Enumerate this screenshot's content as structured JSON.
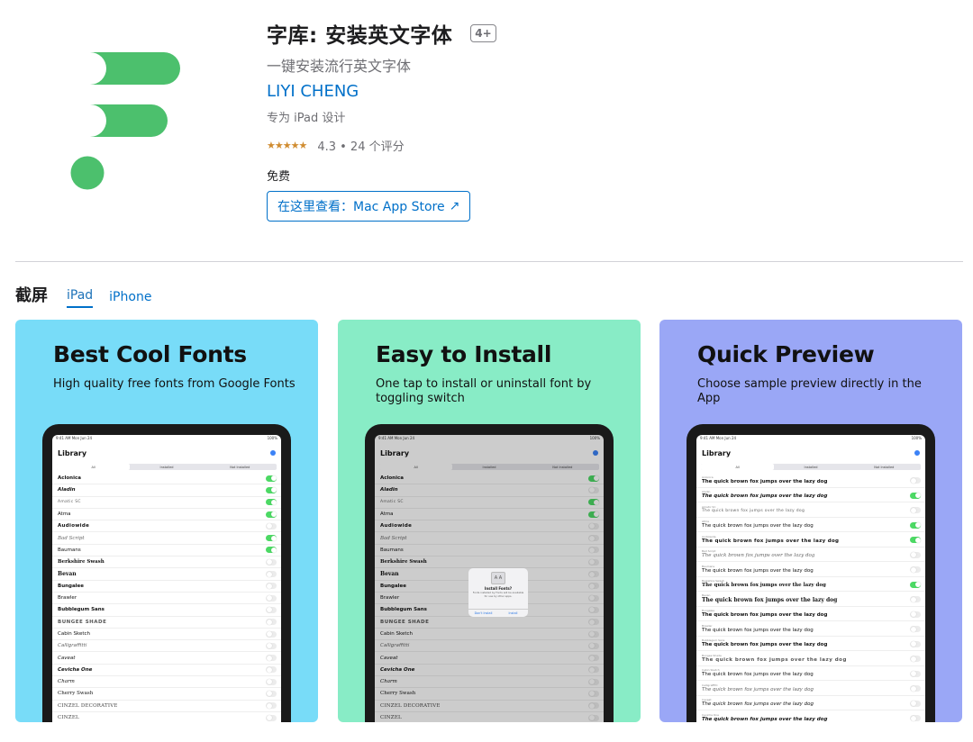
{
  "app": {
    "title": "字库: 安装英文字体",
    "age_rating": "4+",
    "subtitle": "一键安装流行英文字体",
    "developer": "LIYI CHENG",
    "designed_for": "专为 iPad 设计",
    "stars": "★★★★★",
    "rating_text": "4.3 • 24 个评分",
    "rating_value": 4.3,
    "price": "免费",
    "store_button": "在这里查看：Mac App Store",
    "store_arrow": "↗",
    "icon_color": "#4cc06d"
  },
  "screenshots": {
    "title": "截屏",
    "tabs": [
      "iPad",
      "iPhone"
    ],
    "active_tab": "iPad"
  },
  "mock": {
    "status_left": "9:41 AM   Mon Jun 24",
    "status_right": "100%",
    "library": "Library",
    "segments": [
      "All",
      "Installed",
      "Not Installed"
    ],
    "sample_text": "The quick brown fox jumps over the lazy dog",
    "dialog_icon": "A A",
    "dialog_title": "Install Fonts?",
    "dialog_body": "Fonts installed by Fonts will be available for use by other apps.",
    "dialog_left": "Don't Install",
    "dialog_right": "Install"
  },
  "cards": [
    {
      "title": "Best Cool Fonts",
      "subtitle": "High quality free fonts from Google Fonts",
      "bg": "#78dcf8",
      "fonts": [
        {
          "name": "Aclonica",
          "on": true
        },
        {
          "name": "Aladin",
          "on": true
        },
        {
          "name": "Amatic SC",
          "on": true
        },
        {
          "name": "Atma",
          "on": true
        },
        {
          "name": "Audiowide",
          "on": false
        },
        {
          "name": "Bad Script",
          "on": true
        },
        {
          "name": "Baumans",
          "on": true
        },
        {
          "name": "Berkshire Swash",
          "on": false
        },
        {
          "name": "Bevan",
          "on": false
        },
        {
          "name": "Bungalee",
          "on": false
        },
        {
          "name": "Brawler",
          "on": false
        },
        {
          "name": "Bubblegum Sans",
          "on": false
        },
        {
          "name": "BUNGEE SHADE",
          "on": false
        },
        {
          "name": "Cabin Sketch",
          "on": false
        },
        {
          "name": "Calligraffitti",
          "on": false
        },
        {
          "name": "Caveat",
          "on": false
        },
        {
          "name": "Cevicha One",
          "on": false
        },
        {
          "name": "Charm",
          "on": false
        },
        {
          "name": "Cherry Swash",
          "on": false
        },
        {
          "name": "CINZEL DECORATIVE",
          "on": false
        },
        {
          "name": "CINZEL",
          "on": false
        }
      ]
    },
    {
      "title": "Easy to Install",
      "subtitle": "One tap to install or uninstall font by toggling switch",
      "bg": "#88ecc6",
      "fonts": [
        {
          "name": "Aclonica",
          "on": true
        },
        {
          "name": "Aladin",
          "on": false
        },
        {
          "name": "Amatic SC",
          "on": true
        },
        {
          "name": "Atma",
          "on": true
        },
        {
          "name": "Audiowide",
          "on": false
        },
        {
          "name": "Bad Script",
          "on": false
        },
        {
          "name": "Baumans",
          "on": false
        },
        {
          "name": "Berkshire Swash",
          "on": false
        },
        {
          "name": "Bevan",
          "on": false
        },
        {
          "name": "Bungalee",
          "on": false
        },
        {
          "name": "Brawler",
          "on": false
        },
        {
          "name": "Bubblegum Sans",
          "on": false
        },
        {
          "name": "BUNGEE SHADE",
          "on": false
        },
        {
          "name": "Cabin Sketch",
          "on": false
        },
        {
          "name": "Calligraffitti",
          "on": false
        },
        {
          "name": "Caveat",
          "on": false
        },
        {
          "name": "Cevicha One",
          "on": false
        },
        {
          "name": "Charm",
          "on": false
        },
        {
          "name": "Cherry Swash",
          "on": false
        },
        {
          "name": "CINZEL DECORATIVE",
          "on": false
        },
        {
          "name": "CINZEL",
          "on": false
        }
      ]
    },
    {
      "title": "Quick Preview",
      "subtitle": "Choose sample preview directly in the App",
      "bg": "#9aa7f6",
      "fonts": [
        {
          "name": "Aclonica",
          "on": false
        },
        {
          "name": "Aladin",
          "on": true
        },
        {
          "name": "Amatic SC",
          "on": false
        },
        {
          "name": "Atma",
          "on": true
        },
        {
          "name": "Audiowide",
          "on": true
        },
        {
          "name": "Bad Script",
          "on": false
        },
        {
          "name": "Baumans",
          "on": false
        },
        {
          "name": "Berkshire Swash",
          "on": true
        },
        {
          "name": "Bevan",
          "on": false
        },
        {
          "name": "Bungalee",
          "on": false
        },
        {
          "name": "Brawler",
          "on": false
        },
        {
          "name": "Bubblegum Sans",
          "on": false
        },
        {
          "name": "Bungee Shade",
          "on": false
        },
        {
          "name": "Cabin Sketch",
          "on": false
        },
        {
          "name": "Calligraffitti",
          "on": false
        },
        {
          "name": "Caveat",
          "on": false
        },
        {
          "name": "Cevicha One",
          "on": false
        }
      ]
    }
  ]
}
